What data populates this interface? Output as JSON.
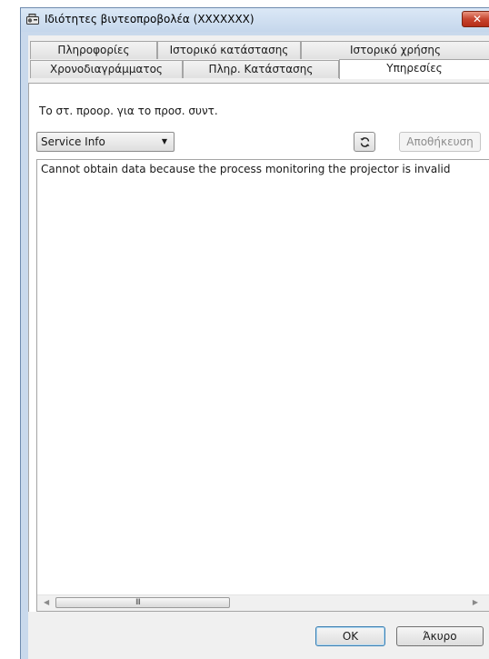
{
  "window": {
    "title": "Ιδιότητες βιντεοπροβολέα (XXXXXXX)",
    "close_label": "✕"
  },
  "tabs": {
    "row1": [
      {
        "label": "Πληροφορίες"
      },
      {
        "label": "Ιστορικό κατάστασης"
      },
      {
        "label": "Ιστορικό χρήσης"
      }
    ],
    "row2": [
      {
        "label": "Χρονοδιαγράμματος"
      },
      {
        "label": "Πληρ. Κατάστασης"
      },
      {
        "label": "Υπηρεσίες",
        "active": true
      }
    ]
  },
  "panel": {
    "note": "Το στ. προορ. για το προσ. συντ.",
    "dropdown_value": "Service Info",
    "save_label": "Αποθήκευση",
    "content_text": "Cannot obtain data because the process monitoring the projector is invalid",
    "scroll_grip": "III"
  },
  "footer": {
    "ok_label": "OK",
    "cancel_label": "Άκυρο"
  },
  "icons": [
    "projector-app-icon",
    "refresh-icon",
    "close-icon",
    "chevron-down-icon",
    "scroll-left-icon",
    "scroll-right-icon"
  ],
  "colors": {
    "window_frame": "#c9d9ec",
    "close_button": "#c7452f",
    "default_button_border": "#3c7fb1",
    "disabled_text": "#8d8d8d"
  }
}
